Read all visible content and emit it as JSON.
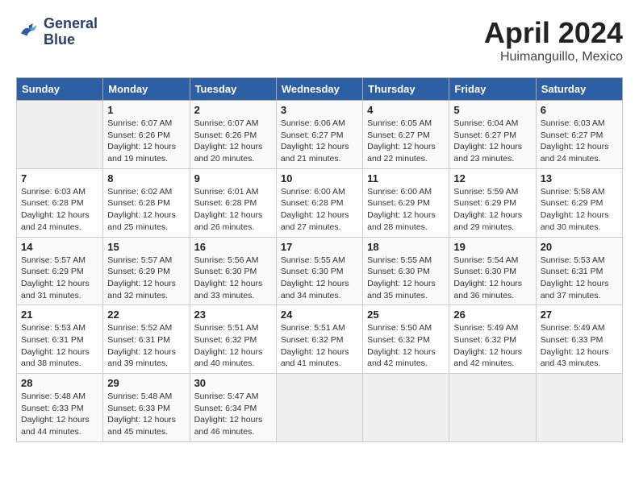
{
  "header": {
    "logo_line1": "General",
    "logo_line2": "Blue",
    "month": "April 2024",
    "location": "Huimanguillo, Mexico"
  },
  "days_of_week": [
    "Sunday",
    "Monday",
    "Tuesday",
    "Wednesday",
    "Thursday",
    "Friday",
    "Saturday"
  ],
  "weeks": [
    [
      {
        "day": "",
        "info": ""
      },
      {
        "day": "1",
        "info": "Sunrise: 6:07 AM\nSunset: 6:26 PM\nDaylight: 12 hours\nand 19 minutes."
      },
      {
        "day": "2",
        "info": "Sunrise: 6:07 AM\nSunset: 6:26 PM\nDaylight: 12 hours\nand 20 minutes."
      },
      {
        "day": "3",
        "info": "Sunrise: 6:06 AM\nSunset: 6:27 PM\nDaylight: 12 hours\nand 21 minutes."
      },
      {
        "day": "4",
        "info": "Sunrise: 6:05 AM\nSunset: 6:27 PM\nDaylight: 12 hours\nand 22 minutes."
      },
      {
        "day": "5",
        "info": "Sunrise: 6:04 AM\nSunset: 6:27 PM\nDaylight: 12 hours\nand 23 minutes."
      },
      {
        "day": "6",
        "info": "Sunrise: 6:03 AM\nSunset: 6:27 PM\nDaylight: 12 hours\nand 24 minutes."
      }
    ],
    [
      {
        "day": "7",
        "info": "Sunrise: 6:03 AM\nSunset: 6:28 PM\nDaylight: 12 hours\nand 24 minutes."
      },
      {
        "day": "8",
        "info": "Sunrise: 6:02 AM\nSunset: 6:28 PM\nDaylight: 12 hours\nand 25 minutes."
      },
      {
        "day": "9",
        "info": "Sunrise: 6:01 AM\nSunset: 6:28 PM\nDaylight: 12 hours\nand 26 minutes."
      },
      {
        "day": "10",
        "info": "Sunrise: 6:00 AM\nSunset: 6:28 PM\nDaylight: 12 hours\nand 27 minutes."
      },
      {
        "day": "11",
        "info": "Sunrise: 6:00 AM\nSunset: 6:29 PM\nDaylight: 12 hours\nand 28 minutes."
      },
      {
        "day": "12",
        "info": "Sunrise: 5:59 AM\nSunset: 6:29 PM\nDaylight: 12 hours\nand 29 minutes."
      },
      {
        "day": "13",
        "info": "Sunrise: 5:58 AM\nSunset: 6:29 PM\nDaylight: 12 hours\nand 30 minutes."
      }
    ],
    [
      {
        "day": "14",
        "info": "Sunrise: 5:57 AM\nSunset: 6:29 PM\nDaylight: 12 hours\nand 31 minutes."
      },
      {
        "day": "15",
        "info": "Sunrise: 5:57 AM\nSunset: 6:29 PM\nDaylight: 12 hours\nand 32 minutes."
      },
      {
        "day": "16",
        "info": "Sunrise: 5:56 AM\nSunset: 6:30 PM\nDaylight: 12 hours\nand 33 minutes."
      },
      {
        "day": "17",
        "info": "Sunrise: 5:55 AM\nSunset: 6:30 PM\nDaylight: 12 hours\nand 34 minutes."
      },
      {
        "day": "18",
        "info": "Sunrise: 5:55 AM\nSunset: 6:30 PM\nDaylight: 12 hours\nand 35 minutes."
      },
      {
        "day": "19",
        "info": "Sunrise: 5:54 AM\nSunset: 6:30 PM\nDaylight: 12 hours\nand 36 minutes."
      },
      {
        "day": "20",
        "info": "Sunrise: 5:53 AM\nSunset: 6:31 PM\nDaylight: 12 hours\nand 37 minutes."
      }
    ],
    [
      {
        "day": "21",
        "info": "Sunrise: 5:53 AM\nSunset: 6:31 PM\nDaylight: 12 hours\nand 38 minutes."
      },
      {
        "day": "22",
        "info": "Sunrise: 5:52 AM\nSunset: 6:31 PM\nDaylight: 12 hours\nand 39 minutes."
      },
      {
        "day": "23",
        "info": "Sunrise: 5:51 AM\nSunset: 6:32 PM\nDaylight: 12 hours\nand 40 minutes."
      },
      {
        "day": "24",
        "info": "Sunrise: 5:51 AM\nSunset: 6:32 PM\nDaylight: 12 hours\nand 41 minutes."
      },
      {
        "day": "25",
        "info": "Sunrise: 5:50 AM\nSunset: 6:32 PM\nDaylight: 12 hours\nand 42 minutes."
      },
      {
        "day": "26",
        "info": "Sunrise: 5:49 AM\nSunset: 6:32 PM\nDaylight: 12 hours\nand 42 minutes."
      },
      {
        "day": "27",
        "info": "Sunrise: 5:49 AM\nSunset: 6:33 PM\nDaylight: 12 hours\nand 43 minutes."
      }
    ],
    [
      {
        "day": "28",
        "info": "Sunrise: 5:48 AM\nSunset: 6:33 PM\nDaylight: 12 hours\nand 44 minutes."
      },
      {
        "day": "29",
        "info": "Sunrise: 5:48 AM\nSunset: 6:33 PM\nDaylight: 12 hours\nand 45 minutes."
      },
      {
        "day": "30",
        "info": "Sunrise: 5:47 AM\nSunset: 6:34 PM\nDaylight: 12 hours\nand 46 minutes."
      },
      {
        "day": "",
        "info": ""
      },
      {
        "day": "",
        "info": ""
      },
      {
        "day": "",
        "info": ""
      },
      {
        "day": "",
        "info": ""
      }
    ]
  ]
}
